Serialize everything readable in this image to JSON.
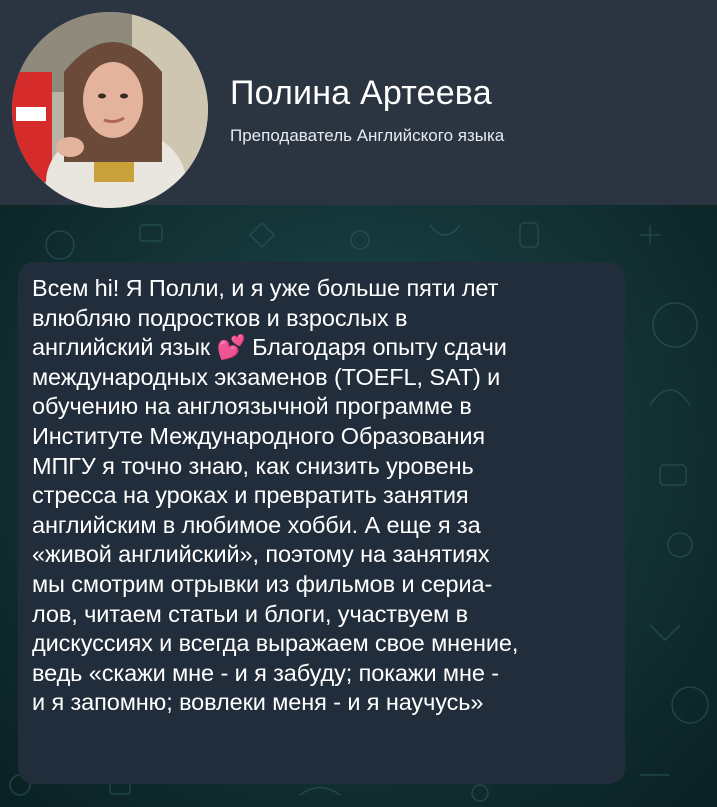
{
  "profile": {
    "name": "Полина Артеева",
    "role": "Преподаватель Английского языка"
  },
  "message": {
    "text": "Всем hi! Я Полли, и я уже больше пяти лет\nвлюбляю подростков и взрослых в\nанглийский язык 💕  Благодаря опыту сдачи\nмеждународных экзаменов (TOEFL, SAT) и\nобучению на англоязычной программе в\nИнституте Международного Образования\nМПГУ я точно знаю, как снизить уровень\nстресса на уроках и превратить занятия\nанглийским в любимое хобби. А еще я за\n«живой английский», поэтому на занятиях\nмы смотрим отрывки из фильмов и сериа-\nлов, читаем статьи и блоги, участвуем в\nдискуссиях и всегда выражаем свое мнение,\nведь «скажи мне - и я забуду; покажи мне -\nи я запомню; вовлеки меня - и я научусь»"
  },
  "colors": {
    "header_bg": "#2b3441",
    "bubble_bg": "#212d3b",
    "chat_bg": "#133234"
  }
}
